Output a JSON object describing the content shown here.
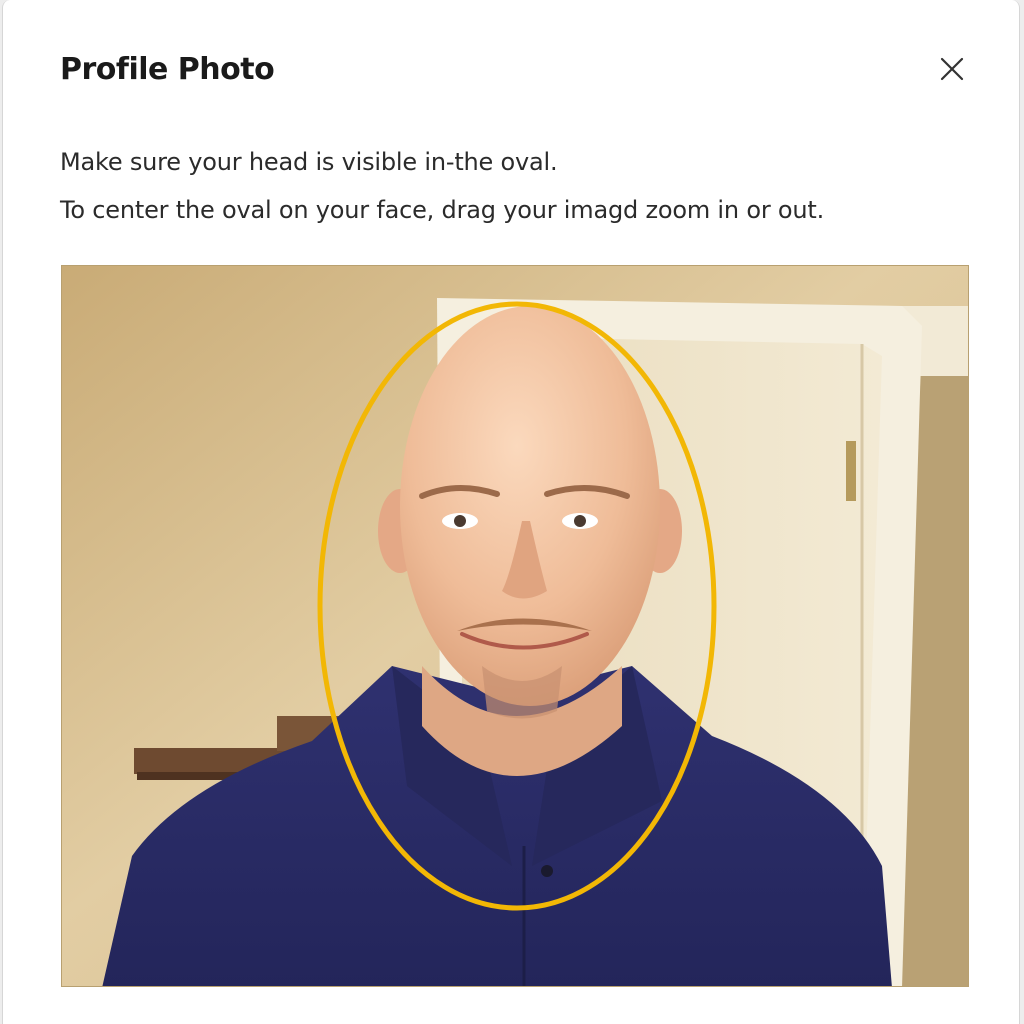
{
  "dialog": {
    "title": "Profile Photo",
    "close_icon": "close-icon"
  },
  "instructions": {
    "line1": "Make sure your head is visible in-the oval.",
    "line2": "To center the oval on your face, drag your imagd zoom in or out."
  },
  "photo": {
    "description_icon": "user-photo",
    "oval_color": "#f2b705"
  },
  "colors": {
    "wall": "#d9c193",
    "door": "#eee4cc",
    "shirt": "#2b2d63",
    "skin": "#f0c09e"
  }
}
